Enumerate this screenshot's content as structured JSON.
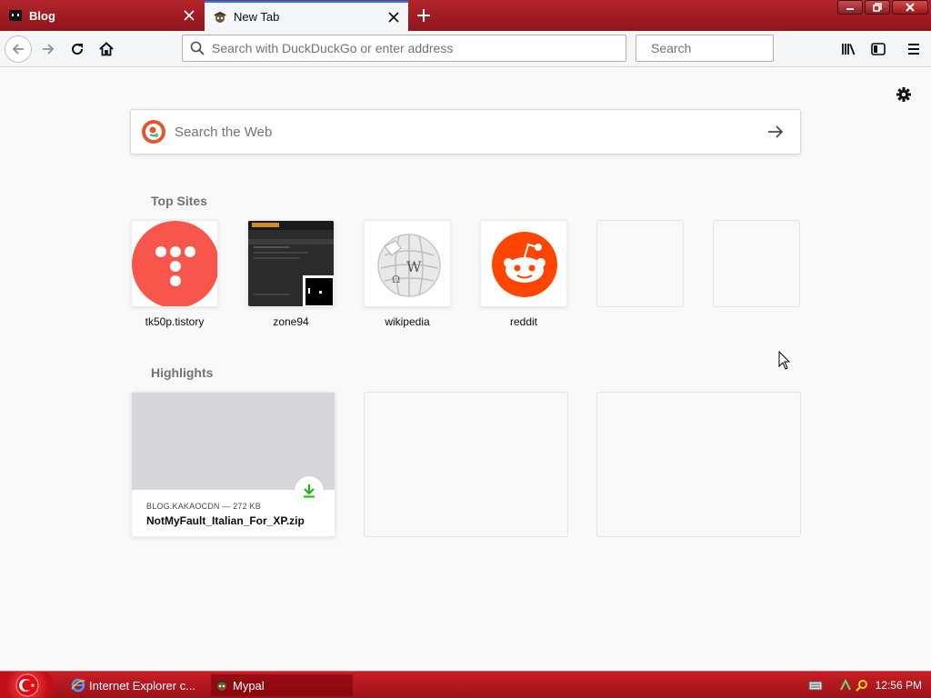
{
  "browser": {
    "tabs": [
      {
        "label": "Blog",
        "active": false
      },
      {
        "label": "New Tab",
        "active": true
      }
    ],
    "url_placeholder": "Search with DuckDuckGo or enter address",
    "search_placeholder": "Search"
  },
  "newtab": {
    "search_placeholder": "Search the Web",
    "top_sites_title": "Top Sites",
    "top_sites": [
      {
        "label": "tk50p.tistory"
      },
      {
        "label": "zone94"
      },
      {
        "label": "wikipedia"
      },
      {
        "label": "reddit"
      }
    ],
    "highlights_title": "Highlights",
    "highlight": {
      "meta": "BLOG.KAKAOCDN — 272 KB",
      "title": "NotMyFault_Italian_For_XP.zip"
    }
  },
  "taskbar": {
    "tasks": [
      {
        "label": "Internet Explorer c..."
      },
      {
        "label": "Mypal"
      }
    ],
    "clock": "12:56 PM"
  },
  "colors": {
    "tab_accent": "#0a84ff",
    "titlebar": "#a01c22",
    "tistory": "#f8564b",
    "reddit": "#ff4500",
    "download": "#12bc00"
  },
  "icons": [
    "blog-favicon",
    "mypal-favicon",
    "close-icon",
    "plus-icon",
    "back-icon",
    "forward-icon",
    "reload-icon",
    "home-icon",
    "search-icon",
    "library-icon",
    "sidebar-icon",
    "menu-icon",
    "gear-icon",
    "duckduckgo-icon",
    "arrow-right-icon",
    "download-icon"
  ]
}
